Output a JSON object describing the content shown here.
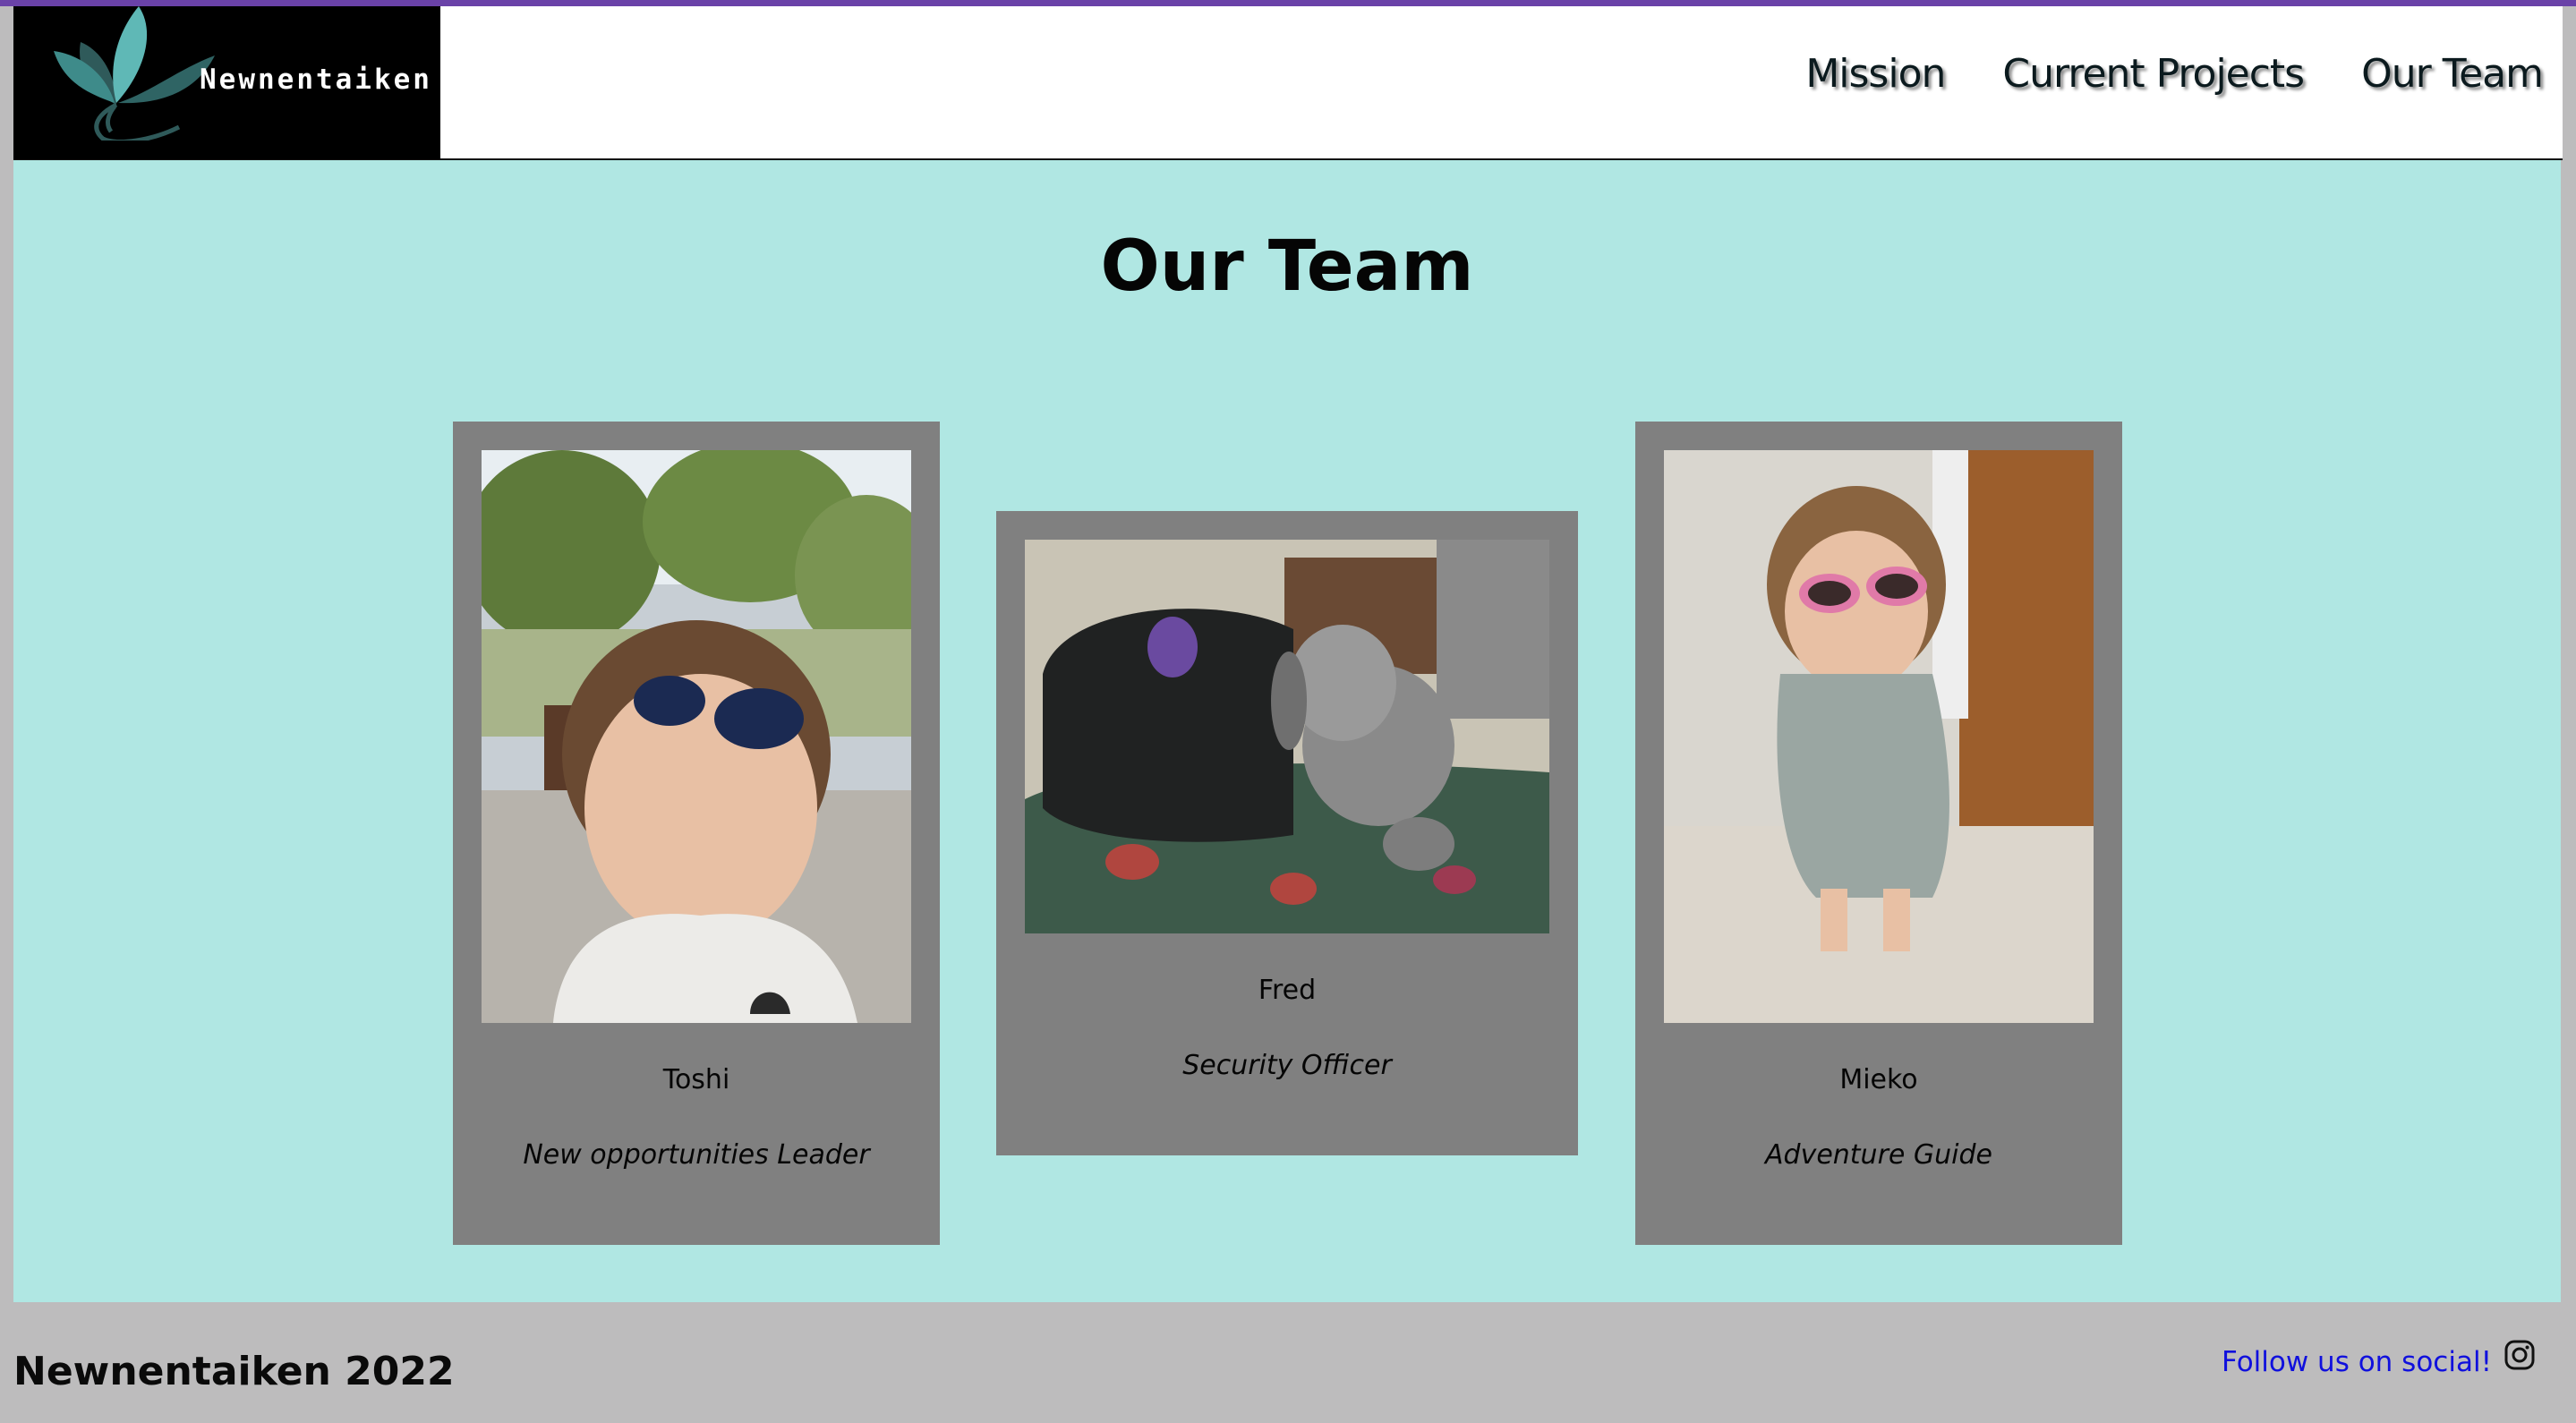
{
  "header": {
    "logo_text": "Newnentaiken",
    "nav": [
      {
        "label": "Mission"
      },
      {
        "label": "Current Projects"
      },
      {
        "label": "Our Team"
      }
    ]
  },
  "main": {
    "title": "Our Team",
    "team": [
      {
        "name": "Toshi",
        "role": "New opportunities Leader"
      },
      {
        "name": "Fred",
        "role": "Security Officer"
      },
      {
        "name": "Mieko",
        "role": "Adventure Guide"
      }
    ]
  },
  "footer": {
    "brand": "Newnentaiken 2022",
    "social_label": "Follow us on social!",
    "social_icon": "instagram-icon"
  },
  "colors": {
    "accent_bar": "#6a42a8",
    "main_bg": "#b0e7e3",
    "card_bg": "#808080",
    "footer_bg": "#bdbcbd",
    "link": "#1010dd"
  }
}
